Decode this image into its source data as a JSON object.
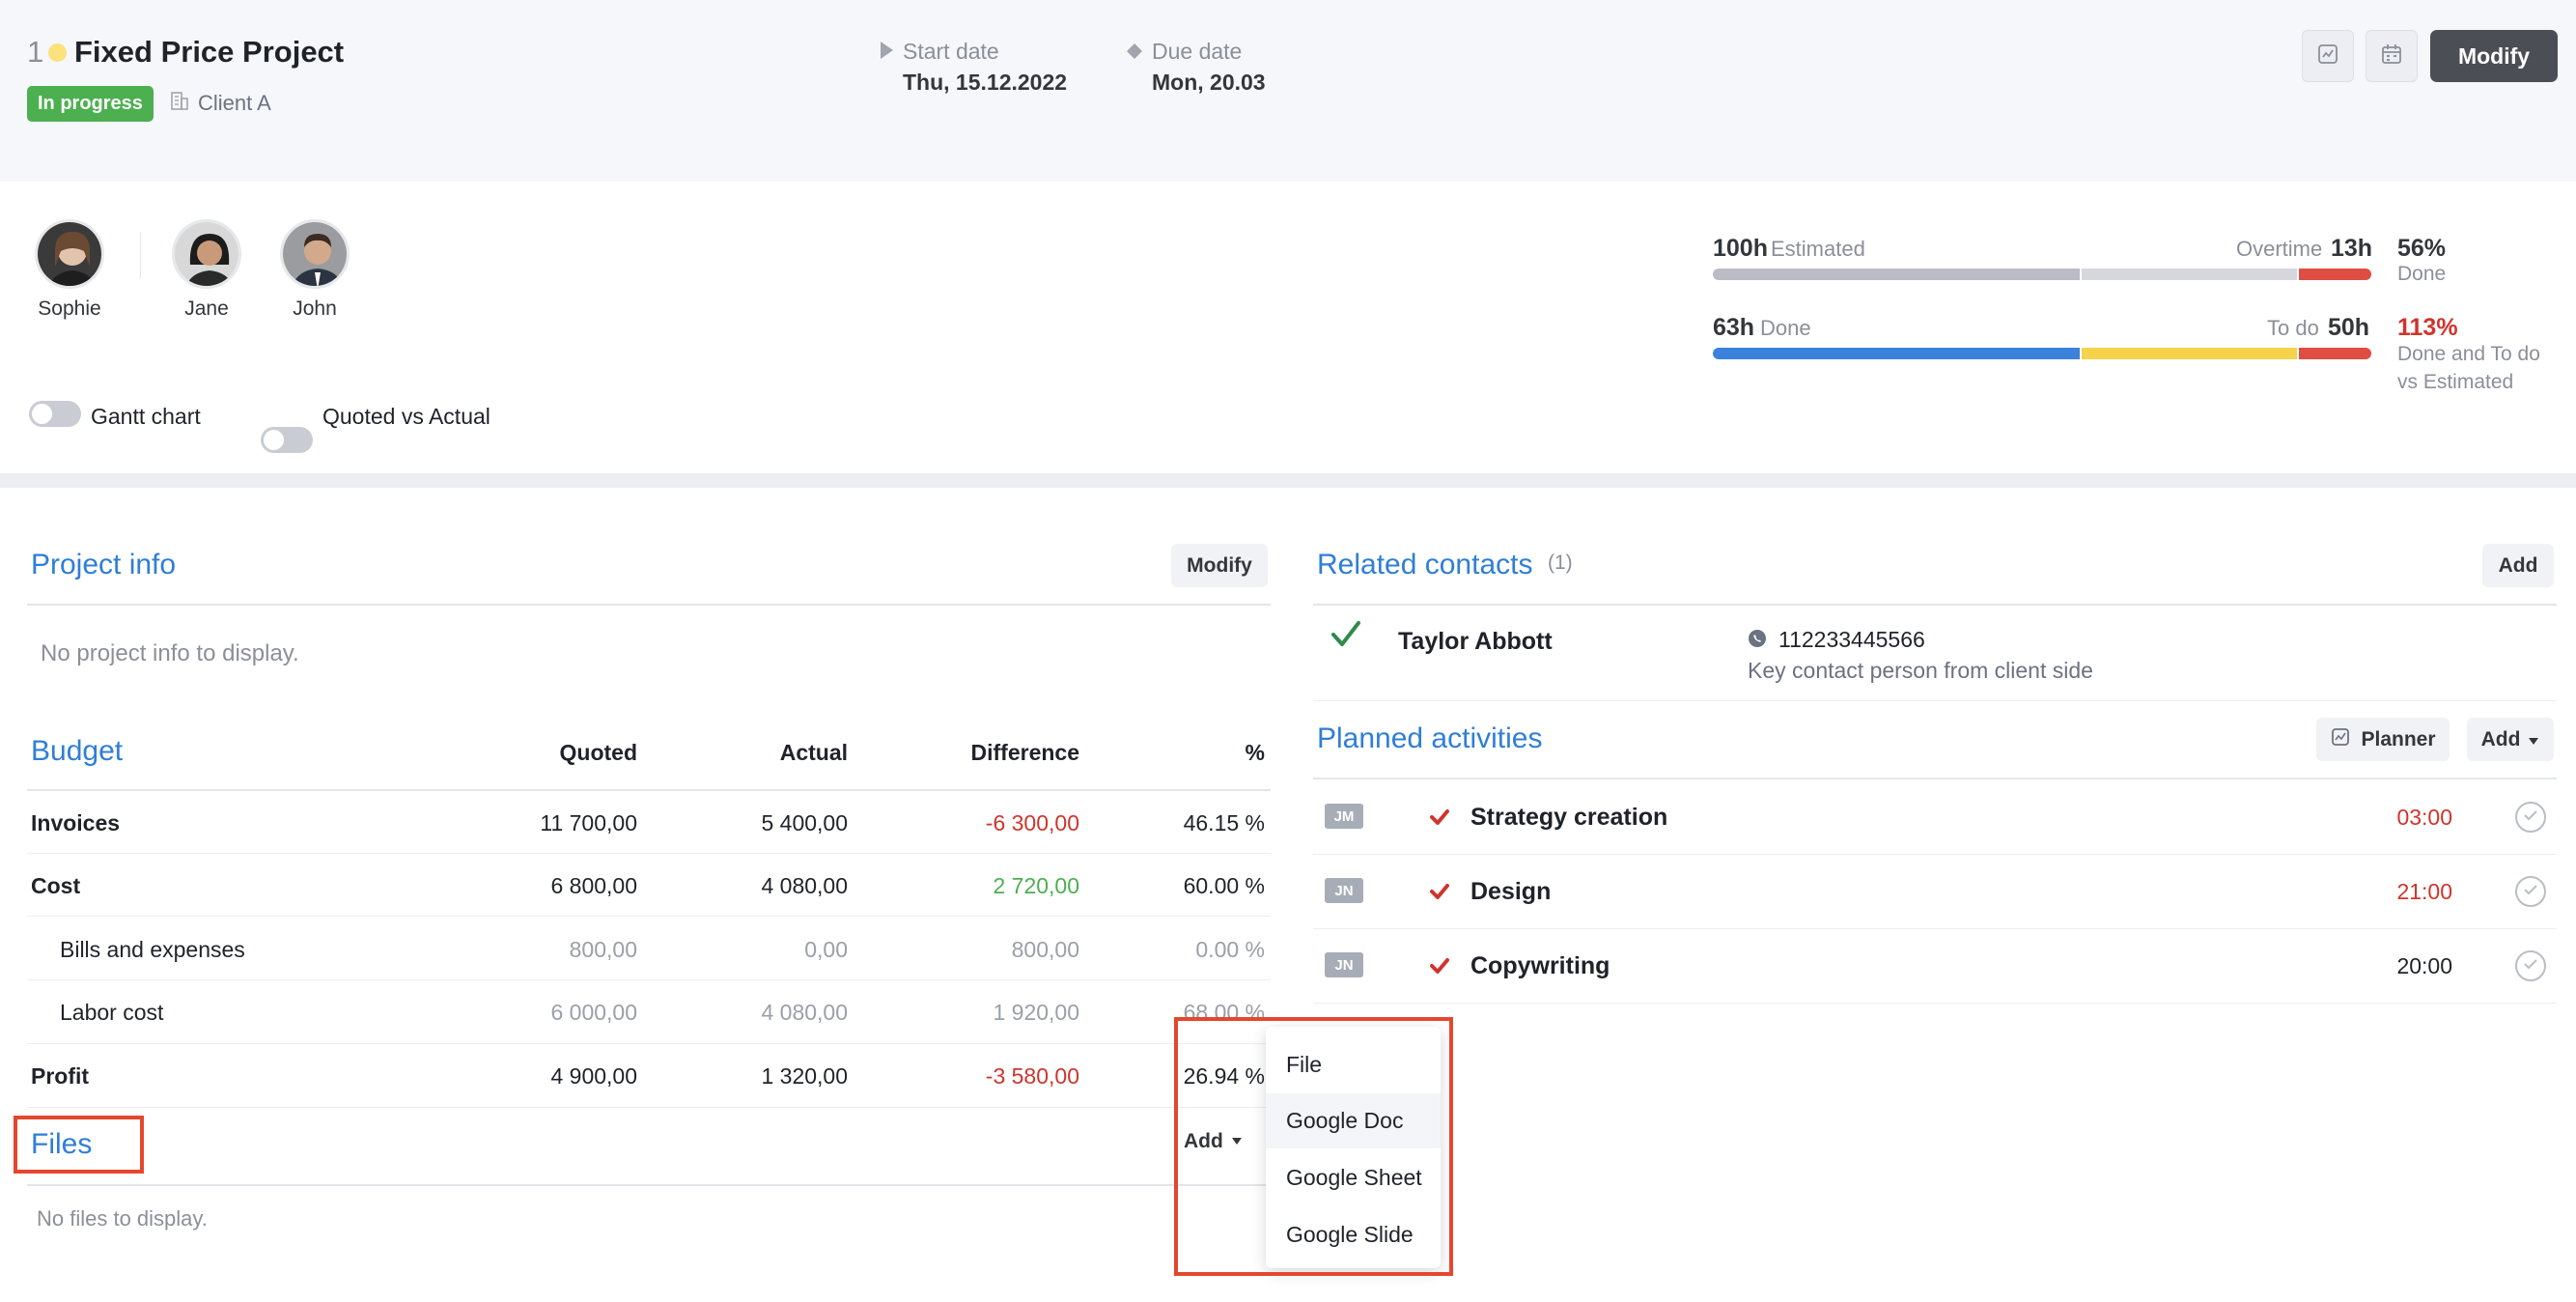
{
  "project": {
    "number": "1",
    "title": "Fixed Price Project",
    "status": "In progress",
    "client": "Client A",
    "start_label": "Start date",
    "start_value": "Thu, 15.12.2022",
    "due_label": "Due date",
    "due_value": "Mon, 20.03",
    "modify_label": "Modify",
    "status_color": "#4caf50",
    "dot_color": "#fbe27c"
  },
  "team": [
    {
      "name": "Sophie"
    },
    {
      "name": "Jane"
    },
    {
      "name": "John"
    }
  ],
  "toggles": {
    "gantt": "Gantt chart",
    "quoted": "Quoted vs Actual"
  },
  "stats": {
    "estimated_value": "100h",
    "estimated_label": "Estimated",
    "overtime_label": "Overtime",
    "overtime_value": "13h",
    "done_pct": "56%",
    "done_pct_label": "Done",
    "done_value": "63h",
    "done_label": "Done",
    "todo_label": "To do",
    "todo_value": "50h",
    "total_pct": "113%",
    "total_pct_label_1": "Done and To do",
    "total_pct_label_2": "vs Estimated",
    "bar1_fill_fraction": 0.56,
    "bar1_overtime_fraction": 0.11,
    "bar2_done_fraction": 0.56,
    "bar2_todo_fraction": 0.33,
    "bar2_over_fraction": 0.11
  },
  "project_info": {
    "title": "Project info",
    "modify_label": "Modify",
    "empty": "No project info to display."
  },
  "budget": {
    "title": "Budget",
    "headers": [
      "Quoted",
      "Actual",
      "Difference",
      "%"
    ],
    "rows": [
      {
        "label": "Invoices",
        "quoted": "11 700,00",
        "actual": "5 400,00",
        "difference": "-6 300,00",
        "pct": "46.15 %"
      },
      {
        "label": "Cost",
        "quoted": "6 800,00",
        "actual": "4 080,00",
        "difference": "2 720,00",
        "pct": "60.00 %"
      },
      {
        "label": "Bills and expenses",
        "quoted": "800,00",
        "actual": "0,00",
        "difference": "800,00",
        "pct": "0.00 %"
      },
      {
        "label": "Labor cost",
        "quoted": "6 000,00",
        "actual": "4 080,00",
        "difference": "1 920,00",
        "pct": "68.00 %"
      },
      {
        "label": "Profit",
        "quoted": "4 900,00",
        "actual": "1 320,00",
        "difference": "-3 580,00",
        "pct": "26.94 %"
      }
    ]
  },
  "files": {
    "title": "Files",
    "add_label": "Add",
    "empty": "No files to display.",
    "menu": [
      "File",
      "Google Doc",
      "Google Sheet",
      "Google Slide"
    ]
  },
  "contacts": {
    "title": "Related contacts",
    "count": "(1)",
    "add_label": "Add",
    "items": [
      {
        "name": "Taylor Abbott",
        "phone": "112233445566",
        "note": "Key contact person from client side"
      }
    ]
  },
  "activities": {
    "title": "Planned activities",
    "planner_label": "Planner",
    "add_label": "Add",
    "items": [
      {
        "initials": "JM",
        "name": "Strategy creation",
        "time": "03:00"
      },
      {
        "initials": "JN",
        "name": "Design",
        "time": "21:00"
      },
      {
        "initials": "JN",
        "name": "Copywriting",
        "time": "20:00"
      }
    ]
  }
}
